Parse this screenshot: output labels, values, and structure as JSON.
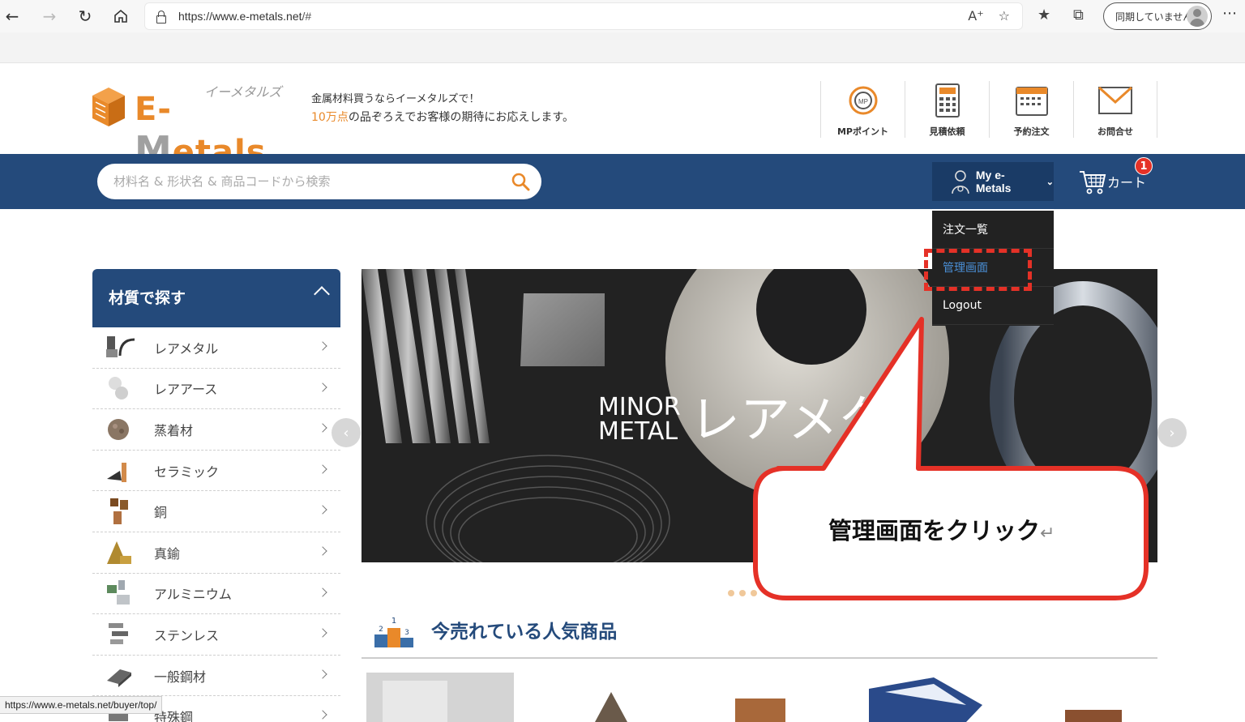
{
  "browser": {
    "url_host": "https://www.e-metals.net",
    "url_path": "/#",
    "sync_label": "同期していません"
  },
  "header": {
    "brand_kana": "イーメタルズ",
    "tagline_line1": "金属材料買うならイーメタルズで！",
    "tagline_hl": "10万点",
    "tagline_rest": "の品ぞろえでお客様の期待にお応えします。",
    "icons": [
      {
        "label": "MPポイント",
        "icon": "coin-icon"
      },
      {
        "label": "見積依頼",
        "icon": "calculator-icon"
      },
      {
        "label": "予約注文",
        "icon": "calendar-icon"
      },
      {
        "label": "お問合せ",
        "icon": "envelope-icon"
      }
    ]
  },
  "nav": {
    "search_placeholder": "材料名 & 形状名 & 商品コードから検索",
    "my_label": "My e-Metals",
    "cart_label": "カート",
    "cart_count": "1"
  },
  "dropdown": {
    "items": [
      "注文一覧",
      "管理画面",
      "Logout"
    ]
  },
  "sidebar": {
    "title": "材質で探す",
    "items": [
      "レアメタル",
      "レアアース",
      "蒸着材",
      "セラミック",
      "銅",
      "真鍮",
      "アルミニウム",
      "ステンレス",
      "一般鋼材",
      "特殊鋼"
    ]
  },
  "banner": {
    "minor": "MINOR",
    "metal": "METAL",
    "jp": "レアメタ"
  },
  "popular": {
    "title": "今売れている人気商品"
  },
  "callout": {
    "text": "管理画面をクリック",
    "return_mark": "↵"
  },
  "status_url": "https://www.e-metals.net/buyer/top/"
}
